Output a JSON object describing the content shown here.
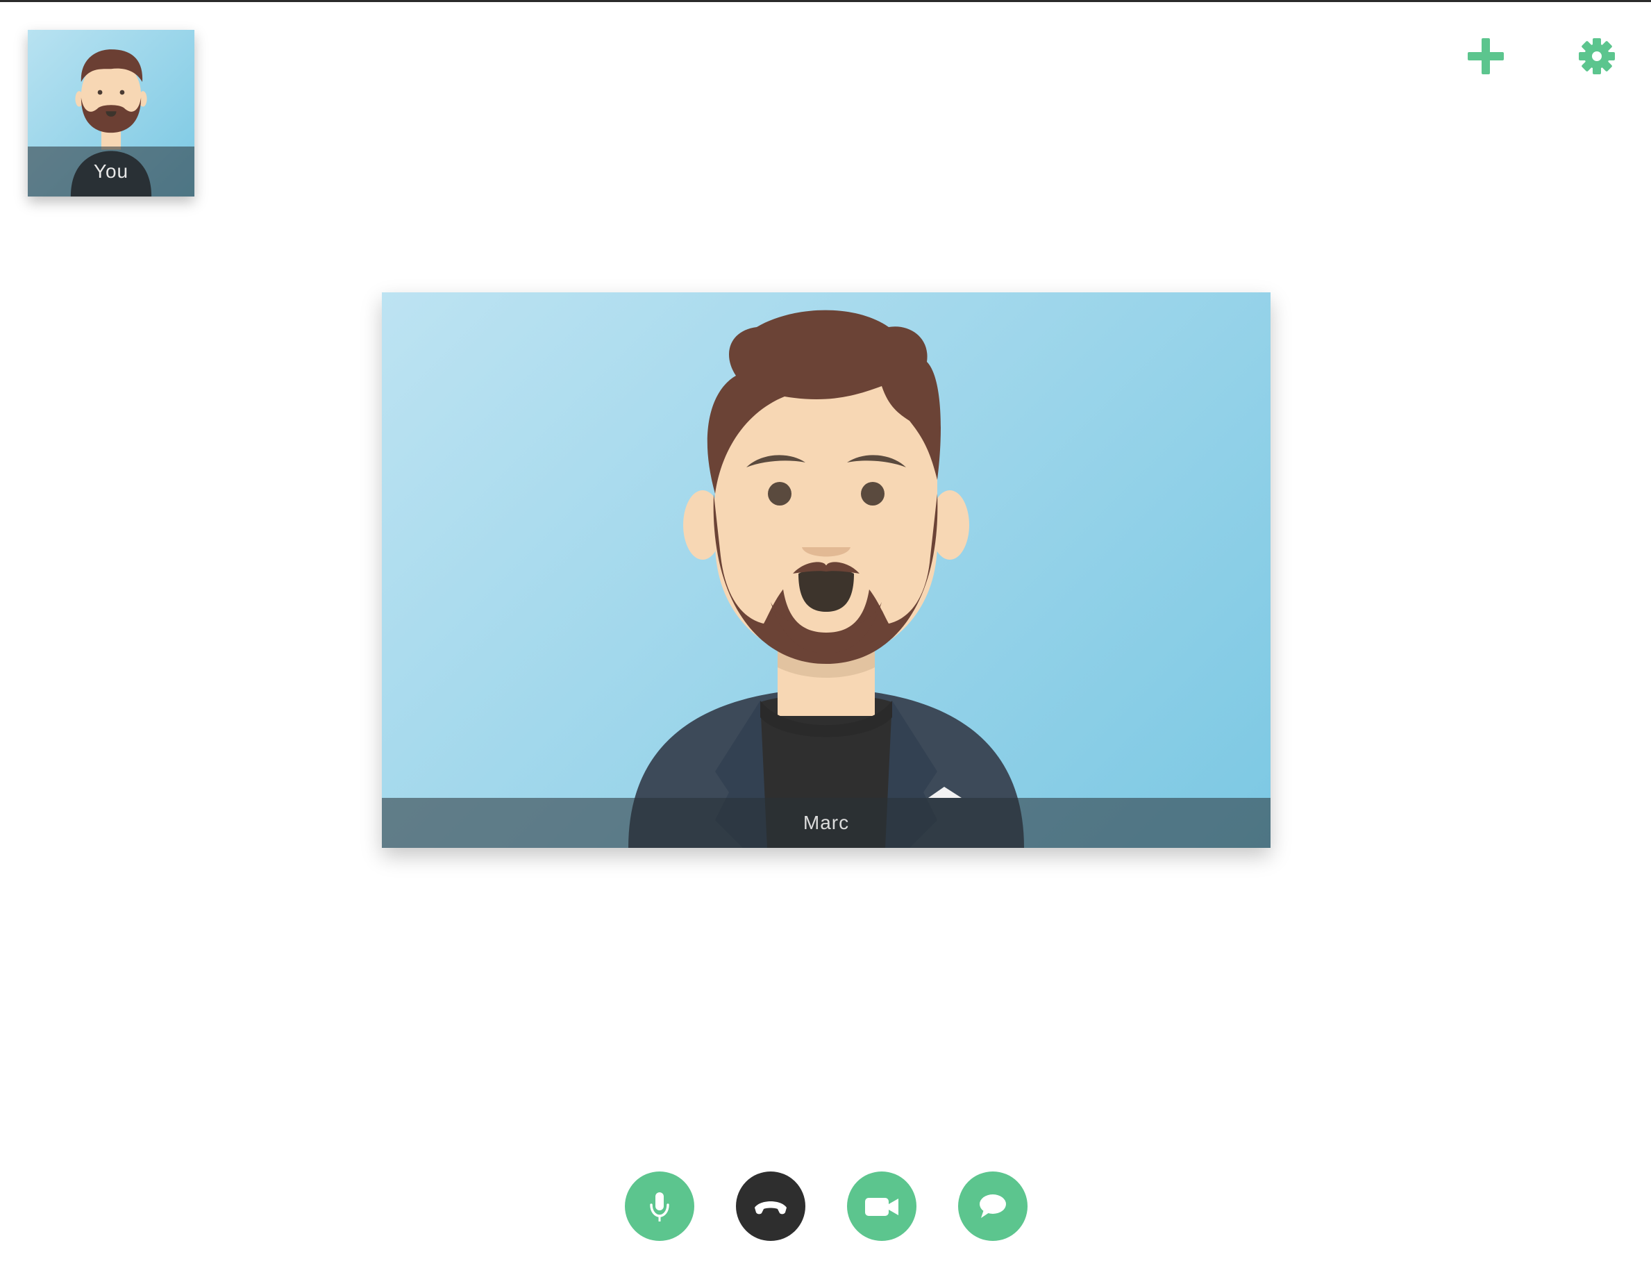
{
  "self_view": {
    "label": "You"
  },
  "remote_view": {
    "label": "Marc"
  },
  "top_controls": {
    "add_icon": "plus-icon",
    "settings_icon": "gear-icon"
  },
  "call_controls": {
    "mic_icon": "microphone-icon",
    "hangup_icon": "phone-hangup-icon",
    "video_icon": "video-camera-icon",
    "chat_icon": "chat-bubble-icon"
  },
  "colors": {
    "accent": "#5cc58e",
    "hangup": "#2e2e2e",
    "tile_bg_light": "#bde3f2",
    "tile_bg_dark": "#7cc8e3"
  }
}
